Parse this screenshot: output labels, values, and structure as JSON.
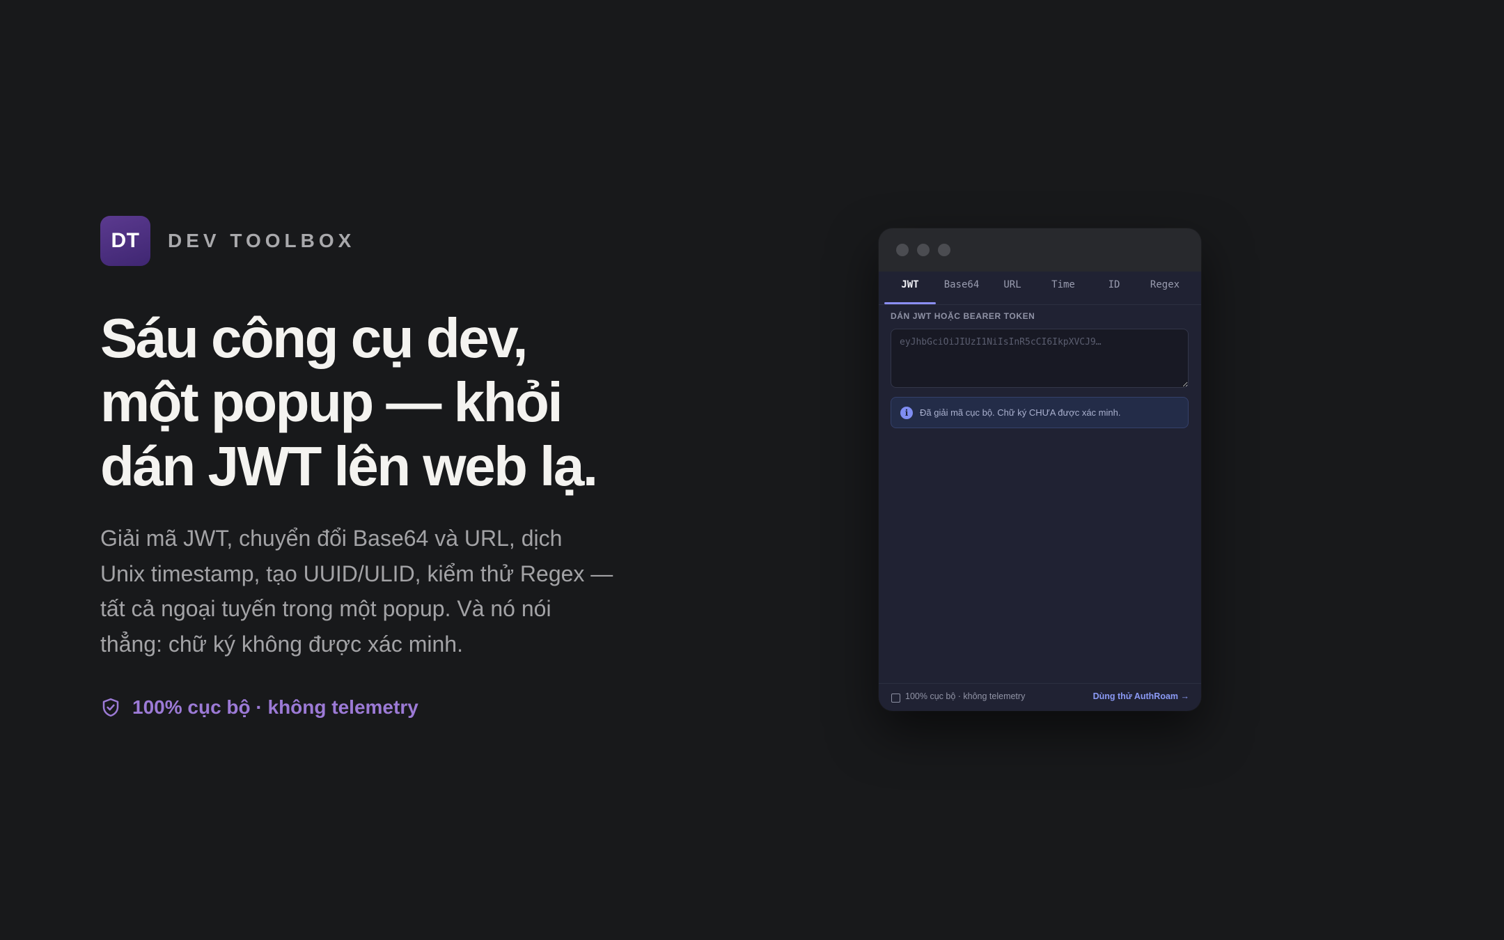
{
  "brand": {
    "logo_text": "DT",
    "name": "DEV TOOLBOX"
  },
  "hero": {
    "headline_lines": [
      "Sáu công cụ dev,",
      "một popup — khỏi",
      "dán JWT lên web lạ."
    ],
    "description_lines": [
      "Giải mã JWT, chuyển đổi Base64 và URL, dịch",
      "Unix timestamp, tạo UUID/ULID, kiểm thử Regex —",
      "tất cả ngoại tuyến trong một popup. Và nó nói",
      "thẳng: chữ ký không được xác minh."
    ],
    "badge": {
      "icon": "shield-check-icon",
      "text": "100% cục bộ · không telemetry"
    }
  },
  "popup": {
    "tabs": [
      {
        "label": "JWT",
        "active": true
      },
      {
        "label": "Base64",
        "active": false
      },
      {
        "label": "URL",
        "active": false
      },
      {
        "label": "Time",
        "active": false
      },
      {
        "label": "ID",
        "active": false
      },
      {
        "label": "Regex",
        "active": false
      }
    ],
    "input": {
      "label": "DÁN JWT HOẶC BEARER TOKEN",
      "placeholder": "eyJhbGciOiJIUzI1NiIsInR5cCI6IkpXVCJ9…",
      "value": ""
    },
    "notice": {
      "icon": "info-icon",
      "text": "Đã giải mã cục bộ. Chữ ký CHƯA được xác minh."
    },
    "footer": {
      "left_text": "100% cục bộ · không telemetry",
      "link_text": "Dùng thử AuthRoam →"
    }
  },
  "colors": {
    "background": "#18191b",
    "accent_purple": "#9c7ad6",
    "tab_underline": "#8b8ff3",
    "link_blue": "#8b9af5"
  }
}
